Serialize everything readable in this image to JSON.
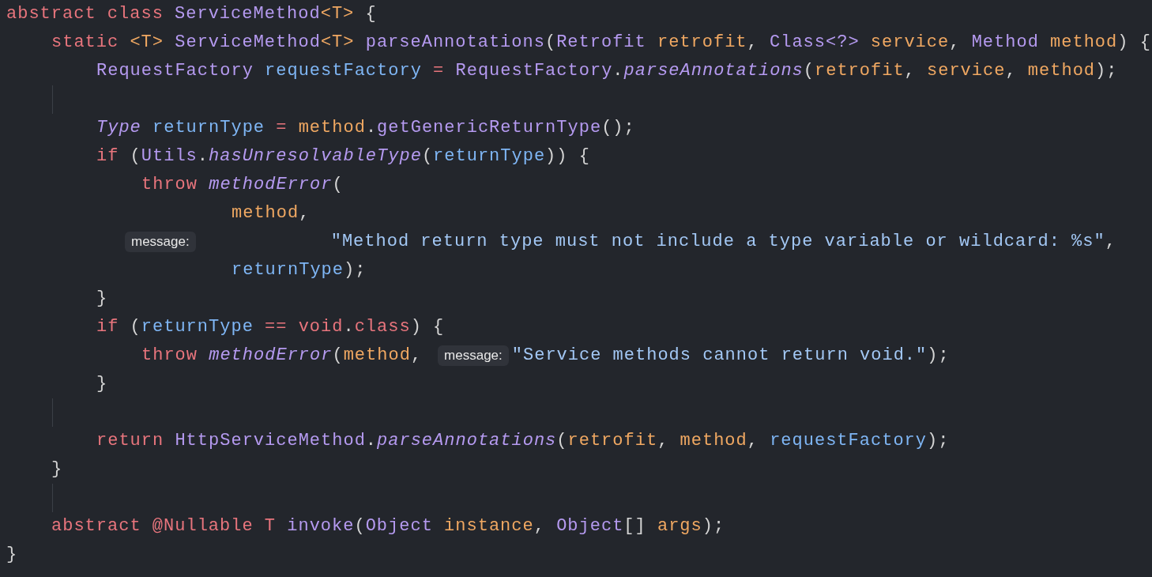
{
  "editor": {
    "lines": [
      {
        "tokens": [
          {
            "kind": "keyword",
            "text": "abstract class "
          },
          {
            "kind": "type",
            "text": "ServiceMethod"
          },
          {
            "kind": "typeparam",
            "text": "<T>"
          },
          {
            "kind": "plain",
            "text": " {"
          }
        ]
      },
      {
        "tokens": [
          {
            "kind": "keyword",
            "text": "\tstatic "
          },
          {
            "kind": "typeparam",
            "text": "<T> "
          },
          {
            "kind": "type",
            "text": "ServiceMethod"
          },
          {
            "kind": "typeparam",
            "text": "<T> "
          },
          {
            "kind": "method",
            "text": "parseAnnotations"
          },
          {
            "kind": "plain",
            "text": "("
          },
          {
            "kind": "type",
            "text": "Retrofit "
          },
          {
            "kind": "param",
            "text": "retrofit"
          },
          {
            "kind": "plain",
            "text": ", "
          },
          {
            "kind": "type",
            "text": "Class<?> "
          },
          {
            "kind": "param",
            "text": "service"
          },
          {
            "kind": "plain",
            "text": ", "
          },
          {
            "kind": "type",
            "text": "Method "
          },
          {
            "kind": "param",
            "text": "method"
          },
          {
            "kind": "plain",
            "text": ") {"
          }
        ]
      },
      {
        "tokens": [
          {
            "kind": "type",
            "text": "\t\tRequestFactory "
          },
          {
            "kind": "variable",
            "text": "requestFactory"
          },
          {
            "kind": "keyword",
            "text": " = "
          },
          {
            "kind": "type",
            "text": "RequestFactory"
          },
          {
            "kind": "plain",
            "text": "."
          },
          {
            "kind": "static",
            "text": "parseAnnotations"
          },
          {
            "kind": "plain",
            "text": "("
          },
          {
            "kind": "param",
            "text": "retrofit"
          },
          {
            "kind": "plain",
            "text": ", "
          },
          {
            "kind": "param",
            "text": "service"
          },
          {
            "kind": "plain",
            "text": ", "
          },
          {
            "kind": "param",
            "text": "method"
          },
          {
            "kind": "plain",
            "text": ");"
          }
        ]
      },
      {
        "blank": true
      },
      {
        "tokens": [
          {
            "kind": "itype",
            "text": "\t\tType "
          },
          {
            "kind": "variable",
            "text": "returnType"
          },
          {
            "kind": "keyword",
            "text": " = "
          },
          {
            "kind": "param",
            "text": "method"
          },
          {
            "kind": "plain",
            "text": "."
          },
          {
            "kind": "method",
            "text": "getGenericReturnType"
          },
          {
            "kind": "plain",
            "text": "();"
          }
        ]
      },
      {
        "tokens": [
          {
            "kind": "keyword",
            "text": "\t\tif "
          },
          {
            "kind": "plain",
            "text": "("
          },
          {
            "kind": "type",
            "text": "Utils"
          },
          {
            "kind": "plain",
            "text": "."
          },
          {
            "kind": "static",
            "text": "hasUnresolvableType"
          },
          {
            "kind": "plain",
            "text": "("
          },
          {
            "kind": "variable",
            "text": "returnType"
          },
          {
            "kind": "plain",
            "text": ")) {"
          }
        ]
      },
      {
        "tokens": [
          {
            "kind": "keyword",
            "text": "\t\t\tthrow "
          },
          {
            "kind": "static",
            "text": "methodError"
          },
          {
            "kind": "plain",
            "text": "("
          }
        ]
      },
      {
        "tokens": [
          {
            "kind": "param",
            "text": "\t\t\t\t\tmethod"
          },
          {
            "kind": "plain",
            "text": ","
          }
        ]
      },
      {
        "tokens": [
          {
            "kind": "hint",
            "text": "message:"
          },
          {
            "kind": "string",
            "text": "\t\t\t\"Method return type must not include a type variable or wildcard: %s\""
          },
          {
            "kind": "plain",
            "text": ","
          }
        ]
      },
      {
        "tokens": [
          {
            "kind": "variable",
            "text": "\t\t\t\t\treturnType"
          },
          {
            "kind": "plain",
            "text": ");"
          }
        ]
      },
      {
        "tokens": [
          {
            "kind": "plain",
            "text": "\t\t}"
          }
        ]
      },
      {
        "tokens": [
          {
            "kind": "keyword",
            "text": "\t\tif "
          },
          {
            "kind": "plain",
            "text": "("
          },
          {
            "kind": "variable",
            "text": "returnType"
          },
          {
            "kind": "keyword",
            "text": " == void"
          },
          {
            "kind": "plain",
            "text": "."
          },
          {
            "kind": "keyword",
            "text": "class"
          },
          {
            "kind": "plain",
            "text": ") {"
          }
        ]
      },
      {
        "tokens": [
          {
            "kind": "keyword",
            "text": "\t\t\tthrow "
          },
          {
            "kind": "static",
            "text": "methodError"
          },
          {
            "kind": "plain",
            "text": "("
          },
          {
            "kind": "param",
            "text": "method"
          },
          {
            "kind": "plain",
            "text": ","
          },
          {
            "kind": "hint",
            "text": "message:"
          },
          {
            "kind": "string",
            "text": "\"Service methods cannot return void.\""
          },
          {
            "kind": "plain",
            "text": ");"
          }
        ]
      },
      {
        "tokens": [
          {
            "kind": "plain",
            "text": "\t\t}"
          }
        ]
      },
      {
        "blank": true
      },
      {
        "tokens": [
          {
            "kind": "keyword",
            "text": "\t\treturn "
          },
          {
            "kind": "type",
            "text": "HttpServiceMethod"
          },
          {
            "kind": "plain",
            "text": "."
          },
          {
            "kind": "static",
            "text": "parseAnnotations"
          },
          {
            "kind": "plain",
            "text": "("
          },
          {
            "kind": "param",
            "text": "retrofit"
          },
          {
            "kind": "plain",
            "text": ", "
          },
          {
            "kind": "param",
            "text": "method"
          },
          {
            "kind": "plain",
            "text": ", "
          },
          {
            "kind": "variable",
            "text": "requestFactory"
          },
          {
            "kind": "plain",
            "text": ");"
          }
        ]
      },
      {
        "tokens": [
          {
            "kind": "plain",
            "text": "\t}"
          }
        ]
      },
      {
        "blank": true
      },
      {
        "tokens": [
          {
            "kind": "keyword",
            "text": "\tabstract @Nullable T "
          },
          {
            "kind": "method",
            "text": "invoke"
          },
          {
            "kind": "plain",
            "text": "("
          },
          {
            "kind": "type",
            "text": "Object "
          },
          {
            "kind": "param",
            "text": "instance"
          },
          {
            "kind": "plain",
            "text": ", "
          },
          {
            "kind": "type",
            "text": "Object"
          },
          {
            "kind": "plain",
            "text": "[] "
          },
          {
            "kind": "param",
            "text": "args"
          },
          {
            "kind": "plain",
            "text": ");"
          }
        ]
      },
      {
        "tokens": [
          {
            "kind": "plain",
            "text": "}"
          }
        ]
      }
    ]
  }
}
